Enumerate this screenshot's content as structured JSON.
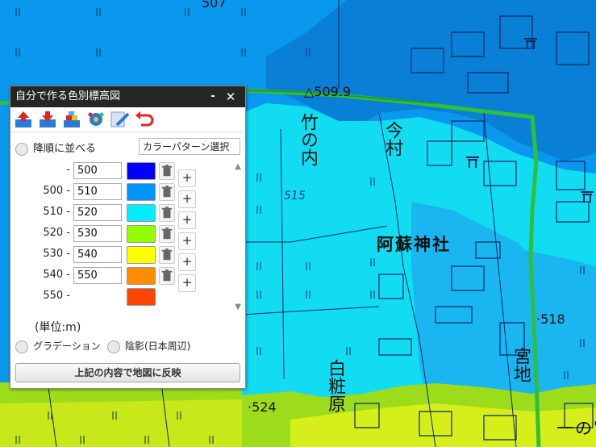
{
  "map": {
    "labels": {
      "peak_509": "△509.9",
      "spot_507": "507",
      "place_takenouchi": "竹の内",
      "place_imamura": "今村",
      "shrine_name": "阿蘇神社",
      "spot_518": "·518",
      "spot_524": "·524",
      "place_shiramatsubara": "白粧原",
      "place_miyaji": "宮地",
      "place_ichinomiya": "一の宮",
      "contour_515": "515"
    },
    "colors": {
      "band_500_510": "#0a98ee",
      "band_510_520": "#12dcf2",
      "band_520_530": "#9ddc1a",
      "band_530_540": "#ecf21a",
      "road": "#2fbf3a"
    }
  },
  "panel": {
    "title": "自分で作る色別標高図",
    "minimize_glyph": "-",
    "close_glyph": "✕",
    "toolbar_icons": [
      "upload-icon",
      "download-icon",
      "blocks-icon",
      "gear-icon",
      "edit-icon",
      "undo-icon"
    ],
    "sort_label": "降順に並べる",
    "pattern_button": "カラーパターン選択",
    "rows": [
      {
        "from": "",
        "to": "500",
        "color": "#0000ff"
      },
      {
        "from": "500",
        "to": "510",
        "color": "#0095ff"
      },
      {
        "from": "510",
        "to": "520",
        "color": "#00eeff"
      },
      {
        "from": "520",
        "to": "530",
        "color": "#91ff00"
      },
      {
        "from": "530",
        "to": "540",
        "color": "#ffff00"
      },
      {
        "from": "540",
        "to": "550",
        "color": "#ff8c00"
      },
      {
        "from": "550",
        "to": "",
        "color": "#ff4400"
      }
    ],
    "unit_label": "(単位:m)",
    "gradation_label": "グラデーション",
    "shading_label": "陰影(日本周辺)",
    "apply_button": "上記の内容で地図に反映"
  }
}
